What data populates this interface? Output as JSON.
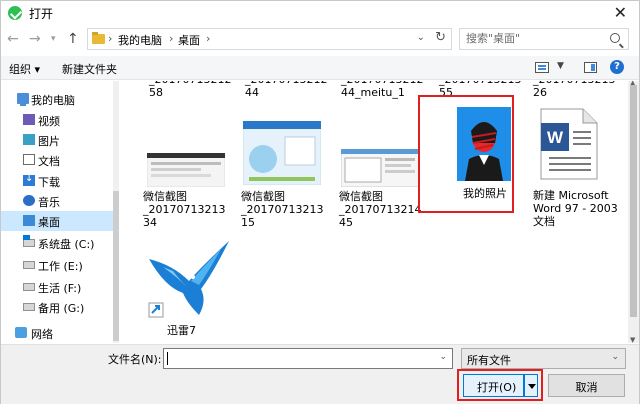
{
  "window": {
    "title": "打开"
  },
  "address": {
    "crumbs": [
      "我的电脑",
      "桌面"
    ]
  },
  "search": {
    "placeholder": "搜索\"桌面\""
  },
  "toolbar": {
    "organize": "组织 ▾",
    "new_folder": "新建文件夹"
  },
  "sidebar": {
    "items": [
      {
        "label": "我的电脑",
        "icon": "computer-icon"
      },
      {
        "label": "视频",
        "icon": "video-folder-icon"
      },
      {
        "label": "图片",
        "icon": "pictures-folder-icon"
      },
      {
        "label": "文档",
        "icon": "documents-folder-icon"
      },
      {
        "label": "下载",
        "icon": "downloads-folder-icon"
      },
      {
        "label": "音乐",
        "icon": "music-folder-icon"
      },
      {
        "label": "桌面",
        "icon": "desktop-folder-icon",
        "selected": true
      },
      {
        "label": "系统盘 (C:)",
        "icon": "system-drive-icon"
      },
      {
        "label": "工作 (E:)",
        "icon": "drive-icon"
      },
      {
        "label": "生活 (F:)",
        "icon": "drive-icon"
      },
      {
        "label": "备用 (G:)",
        "icon": "drive-icon"
      },
      {
        "label": "网络",
        "icon": "network-icon"
      }
    ]
  },
  "files": {
    "partial_row": [
      "_20170713212\n58",
      "_20170713212\n44",
      "_20170713212\n44_meitu_1",
      "_20170713213\n55",
      "_20170713213\n26"
    ],
    "row2": [
      {
        "name": "微信截图\n_20170713213\n34"
      },
      {
        "name": "微信截图\n_20170713213\n15"
      },
      {
        "name": "微信截图\n_20170713214\n45"
      },
      {
        "name": "我的照片"
      },
      {
        "name": "新建 Microsoft\nWord 97 - 2003\n文档"
      }
    ],
    "row3": [
      {
        "name": "迅雷7"
      }
    ]
  },
  "bottom": {
    "filename_label": "文件名(N):",
    "filename_value": "",
    "filetype": "所有文件",
    "open": "打开(O)",
    "cancel": "取消"
  },
  "colors": {
    "accent": "#0078d7",
    "highlight": "#e02020",
    "selection": "#cce8ff"
  }
}
